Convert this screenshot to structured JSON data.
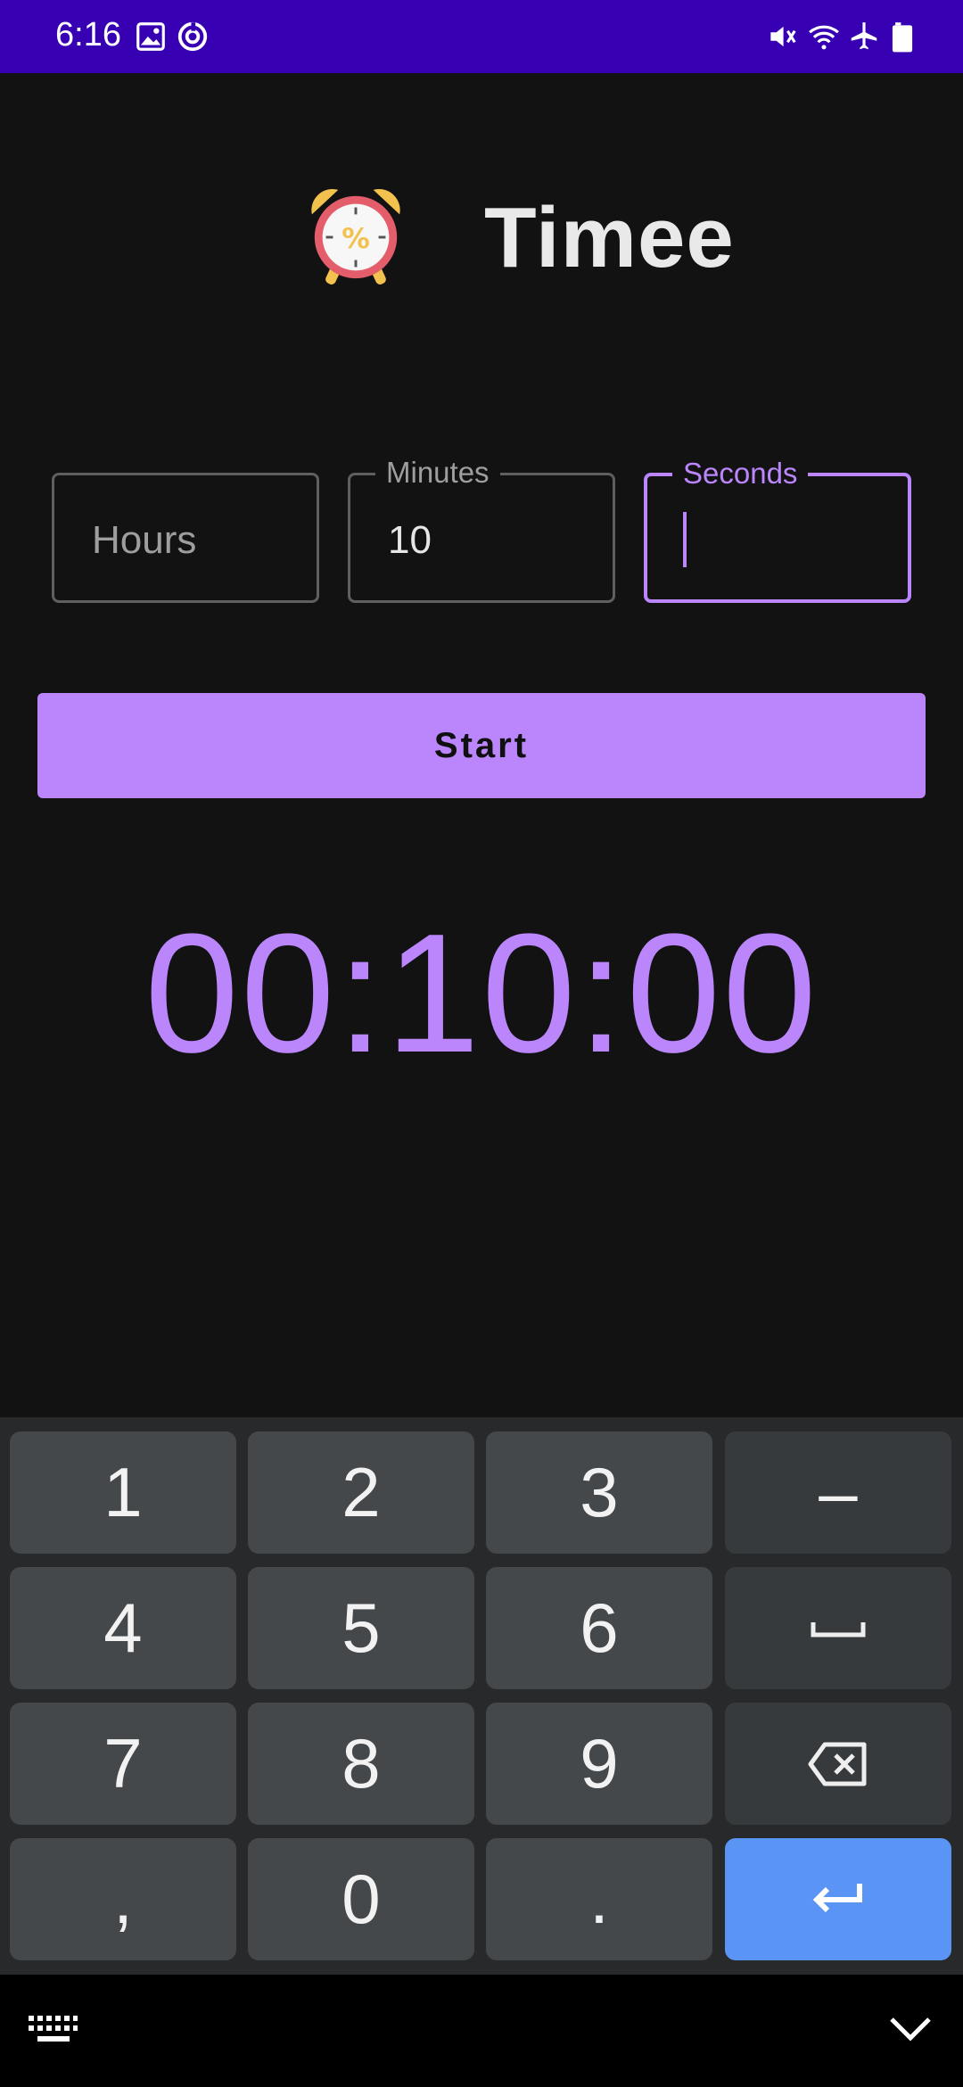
{
  "status_bar": {
    "time": "6:16",
    "left_icons": [
      "image-icon",
      "sync-icon"
    ],
    "right_icons": [
      "mute-icon",
      "wifi-icon",
      "airplane-icon",
      "battery-icon"
    ],
    "background_color": "#3700b3"
  },
  "app": {
    "title": "Timee",
    "icon": "alarm-clock-icon",
    "accent_color": "#bb86fc"
  },
  "inputs": {
    "hours": {
      "placeholder": "Hours",
      "value": ""
    },
    "minutes": {
      "label": "Minutes",
      "value": "10"
    },
    "seconds": {
      "label": "Seconds",
      "value": "",
      "focused": true
    }
  },
  "start_button": {
    "label": "Start"
  },
  "timer": {
    "display": "00:10:00"
  },
  "keyboard": {
    "keys": [
      "1",
      "2",
      "3",
      "–",
      "4",
      "5",
      "6",
      "␣",
      "7",
      "8",
      "9",
      "⌫",
      ",",
      "0",
      ".",
      "↵"
    ],
    "enter_color": "#5a95f5"
  },
  "nav_bar": {
    "left_icon": "keyboard-switch-icon",
    "right_icon": "chevron-down-icon"
  }
}
